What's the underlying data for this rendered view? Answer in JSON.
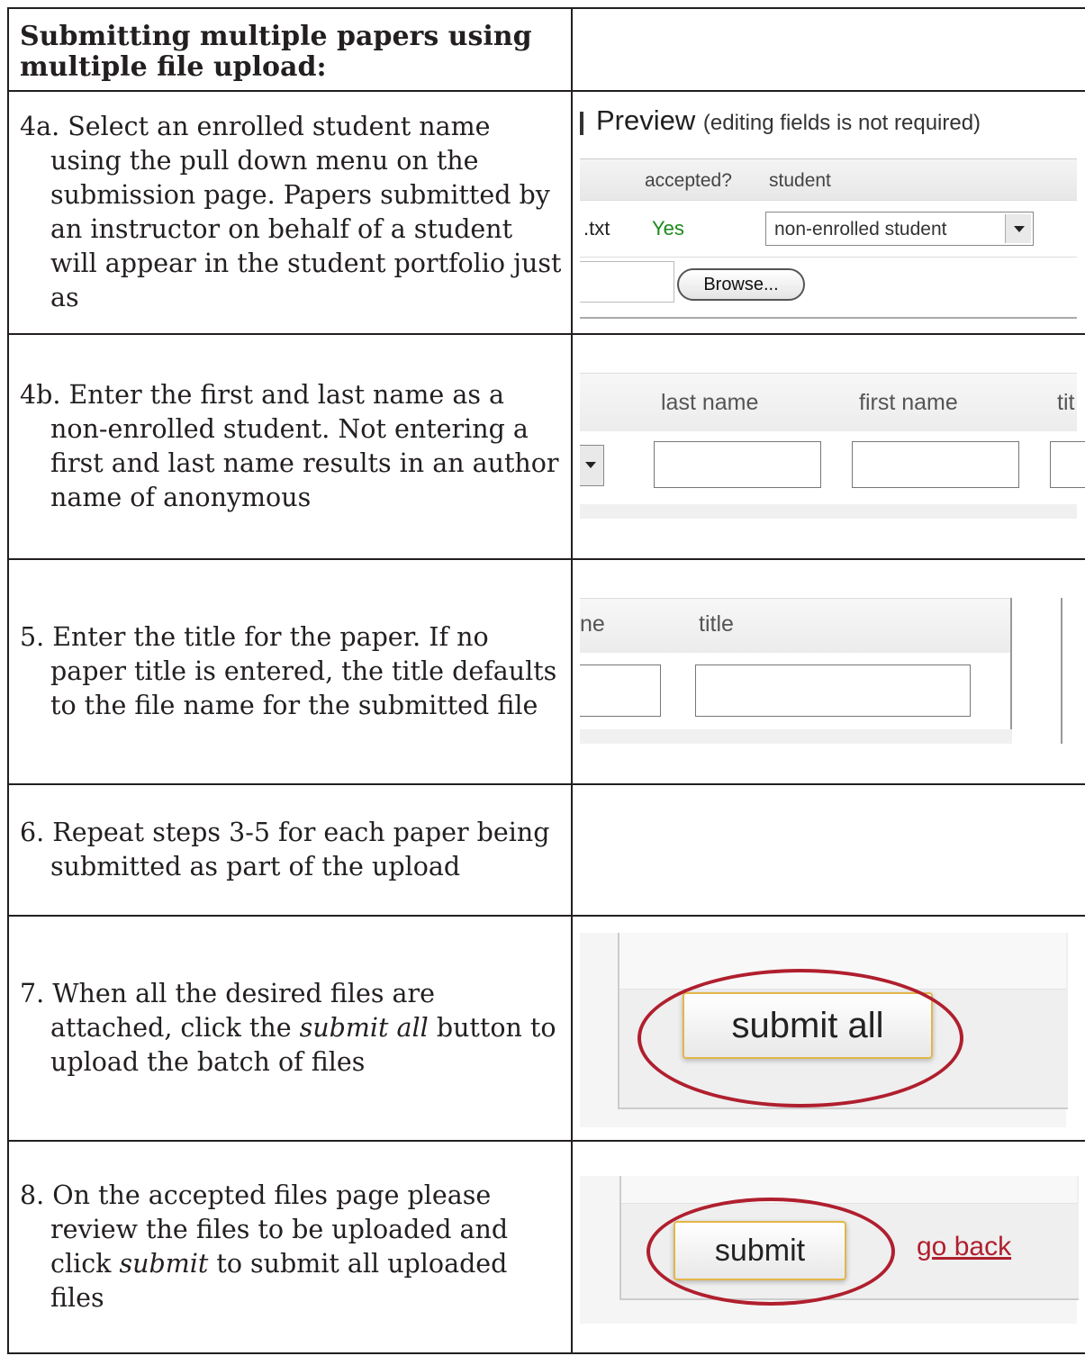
{
  "header": {
    "title_line1": "Submitting multiple papers using",
    "title_line2": "multiple file upload:"
  },
  "steps": {
    "s4a": "4a. Select an enrolled student name using the pull down menu on the submission page. Papers submitted by an instructor on behalf of a student will appear in the student portfolio just as",
    "s4b": "4b. Enter the first and last name as a non-enrolled student. Not entering a first and last name results in an author name of anonymous",
    "s5": "5. Enter the title for the paper. If no paper title is entered, the title defaults to the file name for the submitted file",
    "s6": "6. Repeat steps 3-5 for each paper being submitted as part of the upload",
    "s7_pre": "7. When all the desired files are attached, click the ",
    "s7_em": "submit all",
    "s7_post": " button to upload the batch of files",
    "s8_pre": "8. On the accepted files page please review the files to be uploaded and click ",
    "s8_em": "submit",
    "s8_post": " to submit all uploaded files"
  },
  "shot4a": {
    "preview_word": "Preview",
    "preview_note": "(editing fields is not required)",
    "col_accepted": "accepted?",
    "col_student": "student",
    "file_ext": ".txt",
    "accepted_value": "Yes",
    "student_select": "non-enrolled student",
    "browse_label": "Browse..."
  },
  "shot4b": {
    "col_last": "last name",
    "col_first": "first name",
    "col_title_partial": "tit"
  },
  "shot5": {
    "col_partial": "ne",
    "col_title": "title"
  },
  "shot7": {
    "button": "submit all"
  },
  "shot8": {
    "button": "submit",
    "link": "go back"
  },
  "colors": {
    "highlight_ring": "#b01f2e",
    "accepted_green": "#1a8a1a",
    "button_border": "#e2b64a"
  }
}
